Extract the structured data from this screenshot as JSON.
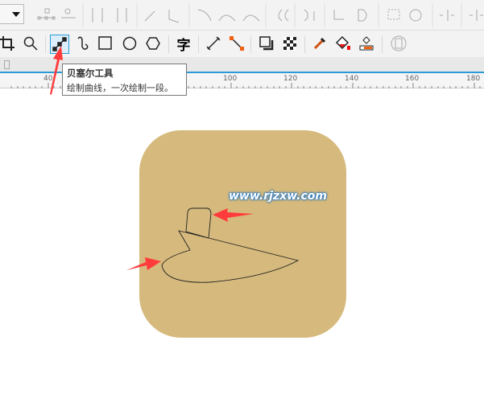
{
  "tooltip": {
    "title": "贝塞尔工具",
    "description": "绘制曲线，一次绘制一段。"
  },
  "ruler": {
    "labels": [
      "40",
      "100",
      "120",
      "140",
      "160",
      "180"
    ]
  },
  "canvas": {
    "watermark": "www.rjzxw.com",
    "shape_color": "#d6b97c",
    "arrow_color": "#ff3b3b"
  },
  "toolbox": {
    "active_tool": "bezier-tool",
    "text_tool_glyph": "字"
  }
}
